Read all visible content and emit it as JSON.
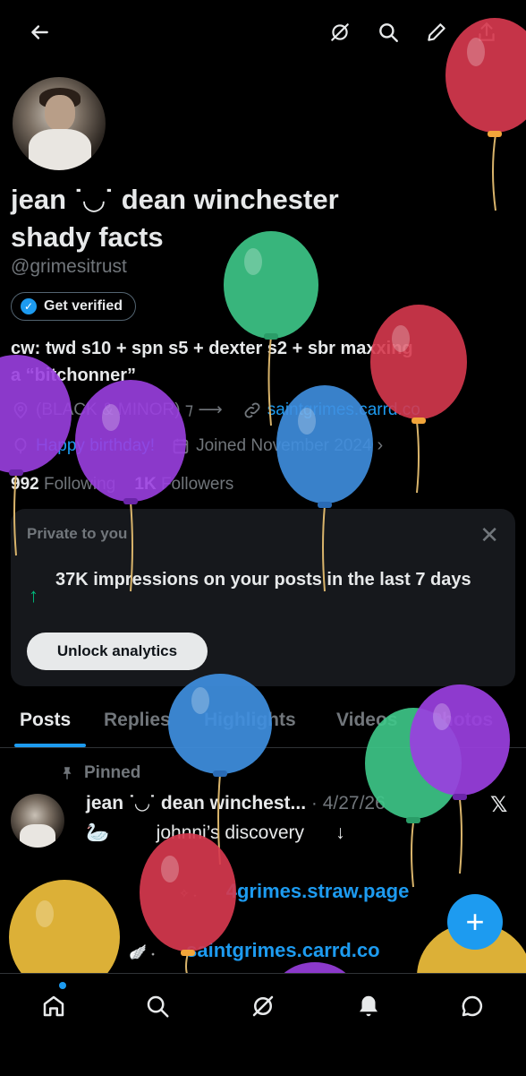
{
  "header": {
    "back_icon": "arrow-left-icon",
    "grok_icon": "grok-icon",
    "search_icon": "search-icon",
    "edit_icon": "pencil-icon",
    "share_icon": "share-icon"
  },
  "profile": {
    "name_line1": "jean ˙◡˙ dean winchester",
    "name_line2": "shady facts",
    "handle": "@grimesitrust",
    "verify_label": "Get verified",
    "bio_line1": "cw: twd s10 + spn s5 + dexter s2 + sbr maxxing",
    "bio_line2": "a “bitchonner”",
    "location": "(BLACK & MINOR) ⁊ ⟶",
    "website": "saintgrimes.carrd.co",
    "birthday": "Happy birthday!",
    "joined": "Joined November 2024",
    "following_count": "992",
    "following_label": "Following",
    "followers_count": "1K",
    "followers_label": "Followers"
  },
  "analytics_card": {
    "title": "Private to you",
    "close": "✕",
    "arrow": "↑",
    "impressions": "37K impressions on your posts in the last 7 days",
    "button": "Unlock analytics"
  },
  "tabs": [
    "Posts",
    "Replies",
    "Highlights",
    "Videos",
    "Photos"
  ],
  "pinned_post": {
    "pinned_label": "Pinned",
    "author": "jean ˙◡˙ dean winchest...",
    "date": "· 4/27/26",
    "line1_prefix": "🦢",
    "line1": "johnni’s discovery",
    "line1_suffix": "↓",
    "link1_prefix": "✧ ˖",
    "link1": "4grimes.straw.page",
    "link2_prefix": "🪽 ˖",
    "link2": "saintgrimes.carrd.co"
  },
  "fab": "+",
  "colors": {
    "accent": "#1d9bf0",
    "background": "#000000",
    "muted": "#71767b",
    "up_green": "#00ba7c",
    "balloon_red": "#d6384e",
    "balloon_green": "#3ec98a",
    "balloon_blue": "#3f8fe0",
    "balloon_purple": "#9a3fe0",
    "balloon_yellow": "#e8b93a"
  }
}
